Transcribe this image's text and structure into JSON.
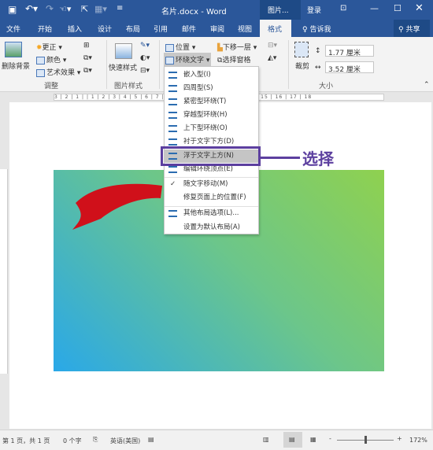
{
  "titlebar": {
    "title": "名片.docx - Word",
    "context_tab": "图片...",
    "login": "登录",
    "icons": [
      "save-icon",
      "undo-icon",
      "redo-icon",
      "touch-mode-icon",
      "select-icon",
      "ribbon-display-icon",
      "minimize-icon",
      "maximize-icon",
      "close-icon"
    ]
  },
  "tabs": [
    "文件",
    "开始",
    "插入",
    "设计",
    "布局",
    "引用",
    "邮件",
    "审阅",
    "视图",
    "格式"
  ],
  "active_tab": "格式",
  "tell_me": "告诉我",
  "share": "共享",
  "ribbon": {
    "remove_bg": "删除背景",
    "corrections": "更正",
    "color": "颜色",
    "artistic": "艺术效果",
    "group_adjust": "调整",
    "quick_styles": "快速样式",
    "group_styles": "图片样式",
    "position": "位置",
    "wrap_text": "环绕文字",
    "send_backward": "下移一层",
    "selection_pane": "选择窗格",
    "crop": "裁剪",
    "height": "1.77 厘米",
    "width": "3.52 厘米",
    "group_size": "大小"
  },
  "ruler": "3 | 2 | 1 |   | 1 | 2 | 3 | 4 | 5 | 6 | 7 | 8 | 9 | 10 | 11 | 12 | 13 | 14 | 15 | 16 | 17 | 18",
  "menu": [
    {
      "label": "嵌入型(I)",
      "icon": true
    },
    {
      "label": "四周型(S)",
      "icon": true
    },
    {
      "label": "紧密型环绕(T)",
      "icon": true
    },
    {
      "label": "穿越型环绕(H)",
      "icon": true
    },
    {
      "label": "上下型环绕(O)",
      "icon": true
    },
    {
      "label": "衬于文字下方(D)",
      "icon": true
    },
    {
      "label": "浮于文字上方(N)",
      "icon": true,
      "selected": true
    },
    {
      "label": "编辑环绕顶点(E)",
      "icon": true
    },
    {
      "label": "随文字移动(M)",
      "checked": true
    },
    {
      "label": "修复页面上的位置(F)"
    },
    {
      "label": "其他布局选项(L)...",
      "icon": true
    },
    {
      "label": "设置为默认布局(A)"
    }
  ],
  "callout": "选择",
  "colors": {
    "accent": "#2b579a",
    "callout": "#5c3f9f"
  },
  "status": {
    "page": "第 1 页，共 1 页",
    "words": "0 个字",
    "language": "英语(美国)",
    "zoom_minus": "-",
    "zoom_plus": "+",
    "zoom": "172%"
  }
}
